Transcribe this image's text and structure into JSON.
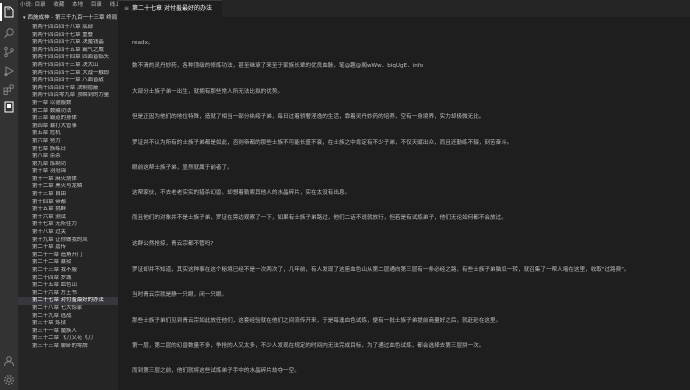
{
  "activity_bar": {
    "icons": [
      "files-icon",
      "search-icon",
      "source-control-icon",
      "run-debug-icon",
      "extensions-icon",
      "book-icon",
      "account-icon",
      "settings-gear-icon"
    ]
  },
  "sidebar": {
    "toolbar": [
      "小说: 目录",
      "收藏",
      "本地",
      "目录",
      "线上"
    ],
    "root": "西施成神 - 第三千九百一十三章 终局",
    "items": [
      "第两千四百四十八章 底部",
      "第两千四百四十七章 重叠",
      "第两千四百四十六章 决魔钱晶",
      "第两千四百四十五章 霸气之威",
      "第两千四百四十四章 四面皆临头",
      "第两千四百四十三章 决大山",
      "第两千四百四十二章 大战一触即",
      "第两千四百四十一章 八面皆敌",
      "第两千四百四十章 决制隐蔽",
      "第两千四百零九章 顶瞬到的力量",
      "第一章 以德服数",
      "第二章 数藏功法",
      "第三章 霸道的身体",
      "第四章 暴打大管事",
      "第五章 危机",
      "第六章 努力",
      "第七章 族练日",
      "第八章 杀杀",
      "第九章 炼制功",
      "第十章 羽冠锦",
      "第十一章 麻火烧体",
      "第十二章 黑火与龙鳞",
      "第十三章 自由",
      "第十四章 帝都",
      "第十五章 挑衅",
      "第十六章 测试",
      "第十七章 无所往力",
      "第十八章 过关",
      "第十九章 让你做我的凤",
      "第二十章 嘉传",
      "第二十一章 造角开门",
      "第二十二章 暴狱",
      "第二十三章 我不服",
      "第二十四章 罗城",
      "第二十五章 血色山",
      "第二十六章 方王书",
      "第二十七章 对付羞最好的办法",
      "第二十八章 七大惊家",
      "第二十九章 逃战",
      "第三十章 炼狱",
      "第三十一章 魔族人",
      "第三十二章 飞刀又花飞刀",
      "第三十三章 聊卧的零牌"
    ],
    "selected_index": 36
  },
  "tab": {
    "icon": "≡",
    "label": "第二十七章 对付羞最好的办法"
  },
  "editor": {
    "paragraphs": [
      "readx。",
      "数不清的灵丹妙药，各种顶级的修炼功法，甚至继承了来至于家族长辈的优良血脉，笔@趣@阁wWw．biqUgE．info",
      "大部分士族子弟一出生，就拥有那些常人所无法比拟的优势。",
      "但是正因为他们的地位特殊，造就了相当一部分纨绔子弟，每日过着骄奢淫逸的生活，靠着灵丹妙药的培养，空有一身境界，实力却极微无比。",
      "罗证并不认为所有的士族子弟都是如此，否则帝都的那些士族不可能长盛不衰，在士族之中肯定有不少子弟，不仅天赋出众，而且还勤练不辍，刻苦奋斗。",
      "眼前这帮士族子弟，显然就属于前者了。",
      "这帮家伙，不去老老实实的猎杀幻兽，却想着勒索其他人的水晶碎片，实在太没有出息。",
      "而且他们的对象并不是士族子弟，罗证在旁边观察了一下，如果有士族子弟路过，他们二话不说就放行，但若是有试炼弟子，他们无论如何都不会放过。",
      "这群公然抢掠，青云宗都不管吗?",
      "罗证却并不知道，其实这种事在这个秘境已经不是一次两次了，几年前，有人发现了这座血色山从第二层通向第三层有一条必经之路，有些士族子弟脑瓜一转，就召集了一帮人堵在这里，收取\"过路费\"。",
      "当时青云宗就是静一只眼，闭一只眼。",
      "那些士族子弟们见到青云宗如此放任他们，这套经验就在他们之间流传开来，于是每逢血色试炼，便有一批士族子弟提前商量好之后，就赶赴在这里。",
      "第一层，第二层的幻兽数量不多，争抢的人又太多，不少人发现在规定的时间内无法完成目标，为了通过血色试炼，都会选择去第三层拼一次。",
      "而到第三层之前，他们就将这些试炼弟子手中的水晶碎片劫夺一空。"
    ]
  }
}
